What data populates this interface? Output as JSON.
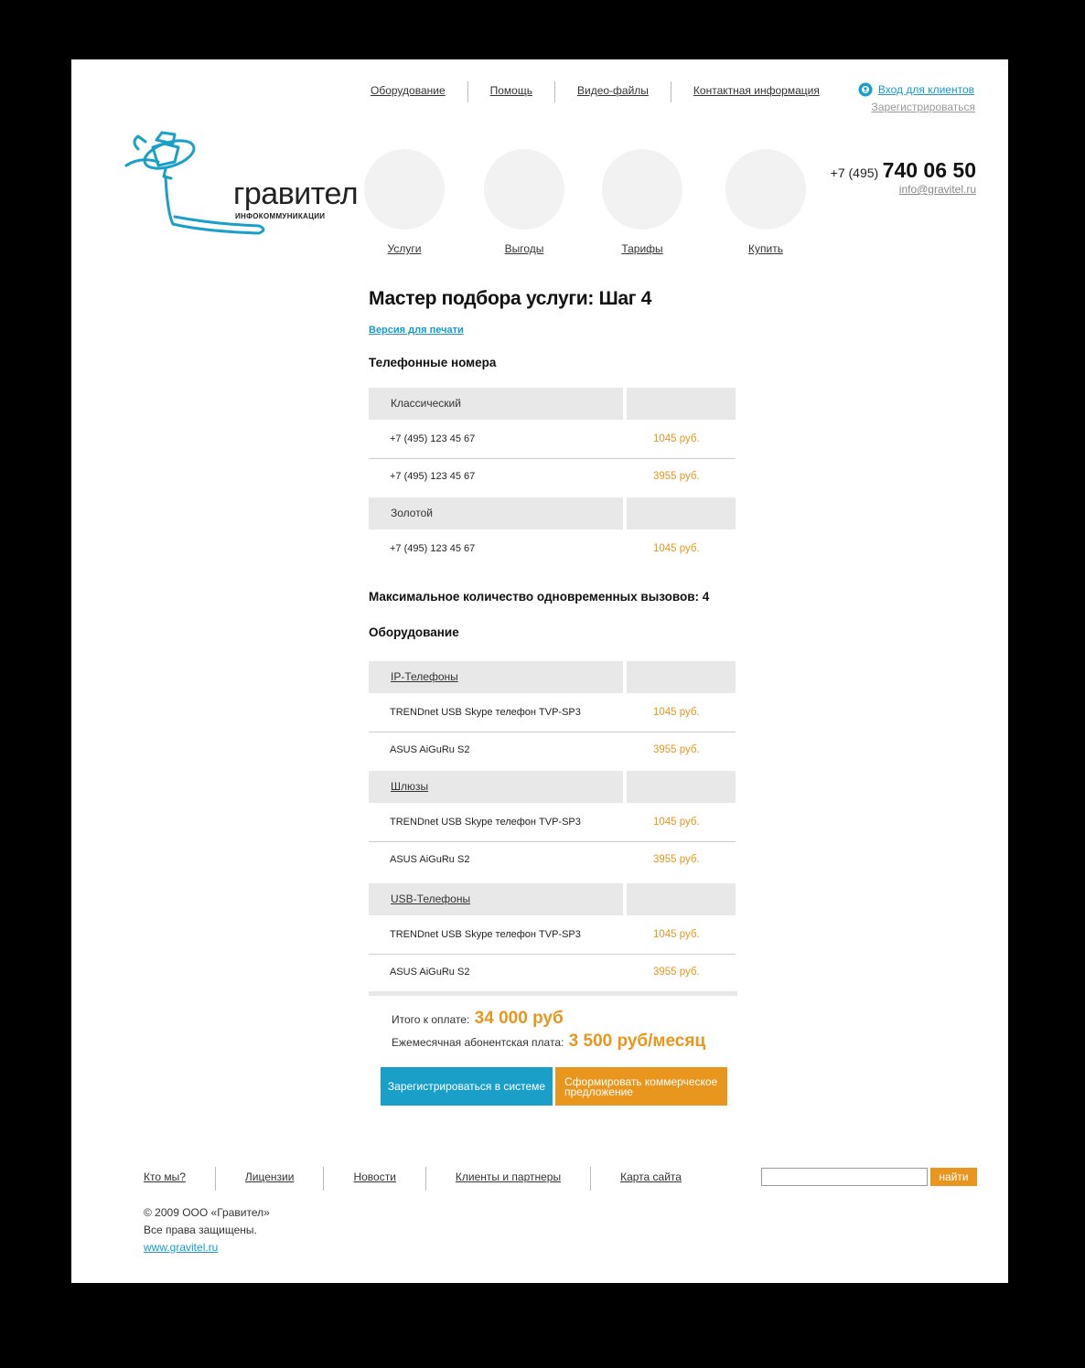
{
  "header": {
    "nav": [
      "Оборудование",
      "Помощь",
      "Видео-файлы",
      "Контактная информация"
    ],
    "login": "Вход для клиентов",
    "register": "Зарегистрироваться",
    "brand": "гравител",
    "brand_sub": "ИНФОКОММУНИКАЦИИ",
    "phone_code": "+7 (495)",
    "phone_number": "740 06 50",
    "email": "info@gravitel.ru"
  },
  "menu": [
    "Услуги",
    "Выгоды",
    "Тарифы",
    "Купить"
  ],
  "main": {
    "title": "Мастер подбора услуги: Шаг 4",
    "print_link": "Версия для печати",
    "numbers_heading": "Телефонные номера",
    "numbers": [
      {
        "category": "Классический",
        "rows": [
          {
            "name": "+7 (495) 123 45 67",
            "price": "1045 руб."
          },
          {
            "name": "+7 (495) 123 45 67",
            "price": "3955 руб."
          }
        ]
      },
      {
        "category": "Золотой",
        "rows": [
          {
            "name": "+7 (495) 123 45 67",
            "price": "1045 руб."
          }
        ]
      }
    ],
    "max_calls": "Максимальное количество одновременных вызовов: 4",
    "equipment_heading": "Оборудование",
    "equipment": [
      {
        "category": "IP-Телефоны",
        "rows": [
          {
            "name": "TRENDnet USB Skype телефон TVP-SP3",
            "price": "1045 руб."
          },
          {
            "name": "ASUS AiGuRu S2",
            "price": "3955 руб."
          }
        ]
      },
      {
        "category": "Шлюзы",
        "rows": [
          {
            "name": "TRENDnet USB Skype телефон TVP-SP3",
            "price": "1045 руб."
          },
          {
            "name": "ASUS AiGuRu S2",
            "price": "3955 руб."
          }
        ]
      },
      {
        "category": "USB-Телефоны",
        "rows": [
          {
            "name": "TRENDnet USB Skype телефон TVP-SP3",
            "price": "1045 руб."
          },
          {
            "name": "ASUS AiGuRu S2",
            "price": "3955 руб."
          }
        ]
      }
    ],
    "total_label": "Итого к оплате:",
    "total_value": "34 000 руб",
    "monthly_label": "Ежемесячная абонентская плата:",
    "monthly_value": "3 500 руб/месяц",
    "btn_register": "Зарегистрироваться в системе",
    "btn_offer": "Сформировать коммерческое предложение"
  },
  "footer": {
    "nav": [
      "Кто мы?",
      "Лицензии",
      "Новости",
      "Клиенты и партнеры",
      "Карта сайта"
    ],
    "search_value": "",
    "search_button": "найти",
    "copyright": "© 2009 ООО «Гравител»",
    "rights": "Все права защищены.",
    "site": "www.gravitel.ru"
  },
  "colors": {
    "accent_blue": "#1aa0c8",
    "accent_orange": "#e8961d",
    "gray_bg": "#e8e8e8"
  }
}
